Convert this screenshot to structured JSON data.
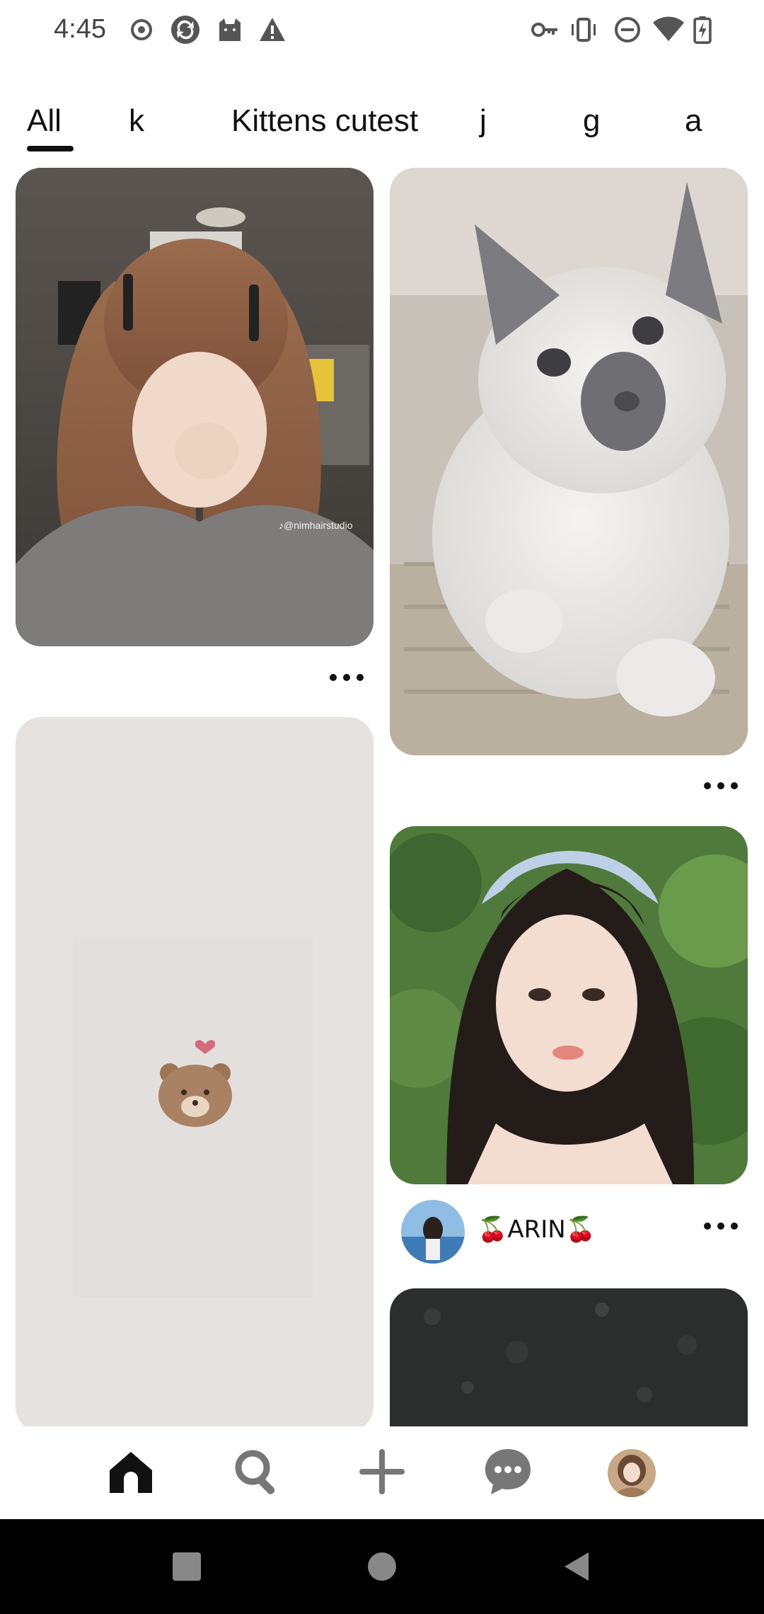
{
  "status_bar": {
    "time": "4:45",
    "left_icons": [
      "record-icon",
      "vpn-sync-icon",
      "cat-icon",
      "warning-icon"
    ],
    "right_icons": [
      "key-icon",
      "vibrate-icon",
      "do-not-disturb-icon",
      "wifi-icon",
      "battery-charging-icon"
    ]
  },
  "tabs": [
    {
      "label": "All",
      "selected": true
    },
    {
      "label": "k",
      "selected": false
    },
    {
      "label": "Kittens cutest",
      "selected": false
    },
    {
      "label": "j",
      "selected": false
    },
    {
      "label": "g",
      "selected": false
    },
    {
      "label": "a",
      "selected": false
    }
  ],
  "feed": {
    "pins": [
      {
        "id": "pin-girl-hair",
        "watermark": "♪@nimhairstudio"
      },
      {
        "id": "pin-kitten"
      },
      {
        "id": "pin-bear-wallpaper"
      },
      {
        "id": "pin-girl-headband",
        "creator_name": "🍒ARIN🍒"
      },
      {
        "id": "pin-dark-texture"
      }
    ]
  },
  "bottom_nav": {
    "items": [
      "home-icon",
      "search-icon",
      "add-icon",
      "messages-icon",
      "profile-avatar"
    ],
    "active": "home-icon"
  },
  "system_nav": {
    "items": [
      "recents-square-icon",
      "home-circle-icon",
      "back-triangle-icon"
    ]
  },
  "colors": {
    "text_primary": "#111111",
    "status_text": "#444444",
    "background": "#ffffff",
    "system_nav_bg": "#000000"
  }
}
